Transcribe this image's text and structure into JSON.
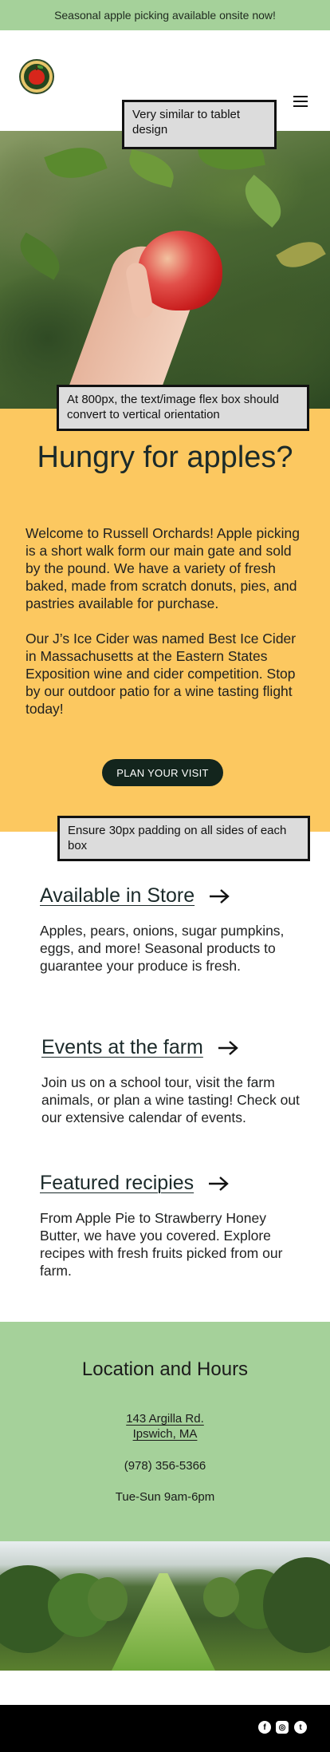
{
  "banner": {
    "text": "Seasonal apple picking available onsite now!"
  },
  "notes": {
    "tablet": "Very similar to tablet design",
    "flexbox": "At 800px, the text/image flex box should convert to vertical orientation",
    "padding": "Ensure 30px padding on all sides of each box"
  },
  "hungry": {
    "title": "Hungry for apples?",
    "p1": "Welcome to Russell Orchards! Apple picking is a short walk form our main gate and sold by the pound. We have a variety of fresh baked, made from scratch donuts, pies, and pastries available for purchase.",
    "p2": "Our J’s Ice Cider was named Best Ice Cider in Massachusetts at the Eastern States Exposition wine and cider competition. Stop by our outdoor patio for a wine tasting flight today!",
    "button": "PLAN YOUR VISIT"
  },
  "features": [
    {
      "title": "Available in Store",
      "desc": "Apples, pears, onions, sugar pumpkins, eggs, and more! Seasonal products to guarantee your produce is fresh."
    },
    {
      "title": "Events at the farm",
      "desc": "Join us on a school tour, visit the farm animals, or plan a wine tasting! Check out our extensive calendar of events."
    },
    {
      "title": "Featured recipies",
      "desc": "From Apple Pie to Strawberry Honey Butter, we have you covered. Explore recipes with fresh fruits picked from our farm."
    }
  ],
  "location": {
    "title": "Location and Hours",
    "address_line1": "143 Argilla Rd.",
    "address_line2": "Ipswich, MA",
    "phone": "(978) 356-5366",
    "hours": "Tue-Sun 9am-6pm"
  },
  "social": {
    "facebook": "f",
    "instagram": "◎",
    "twitter": "t"
  },
  "colors": {
    "banner": "#a5d19a",
    "hungry_bg": "#fcc860",
    "button": "#13251d",
    "footer": "#000000"
  }
}
